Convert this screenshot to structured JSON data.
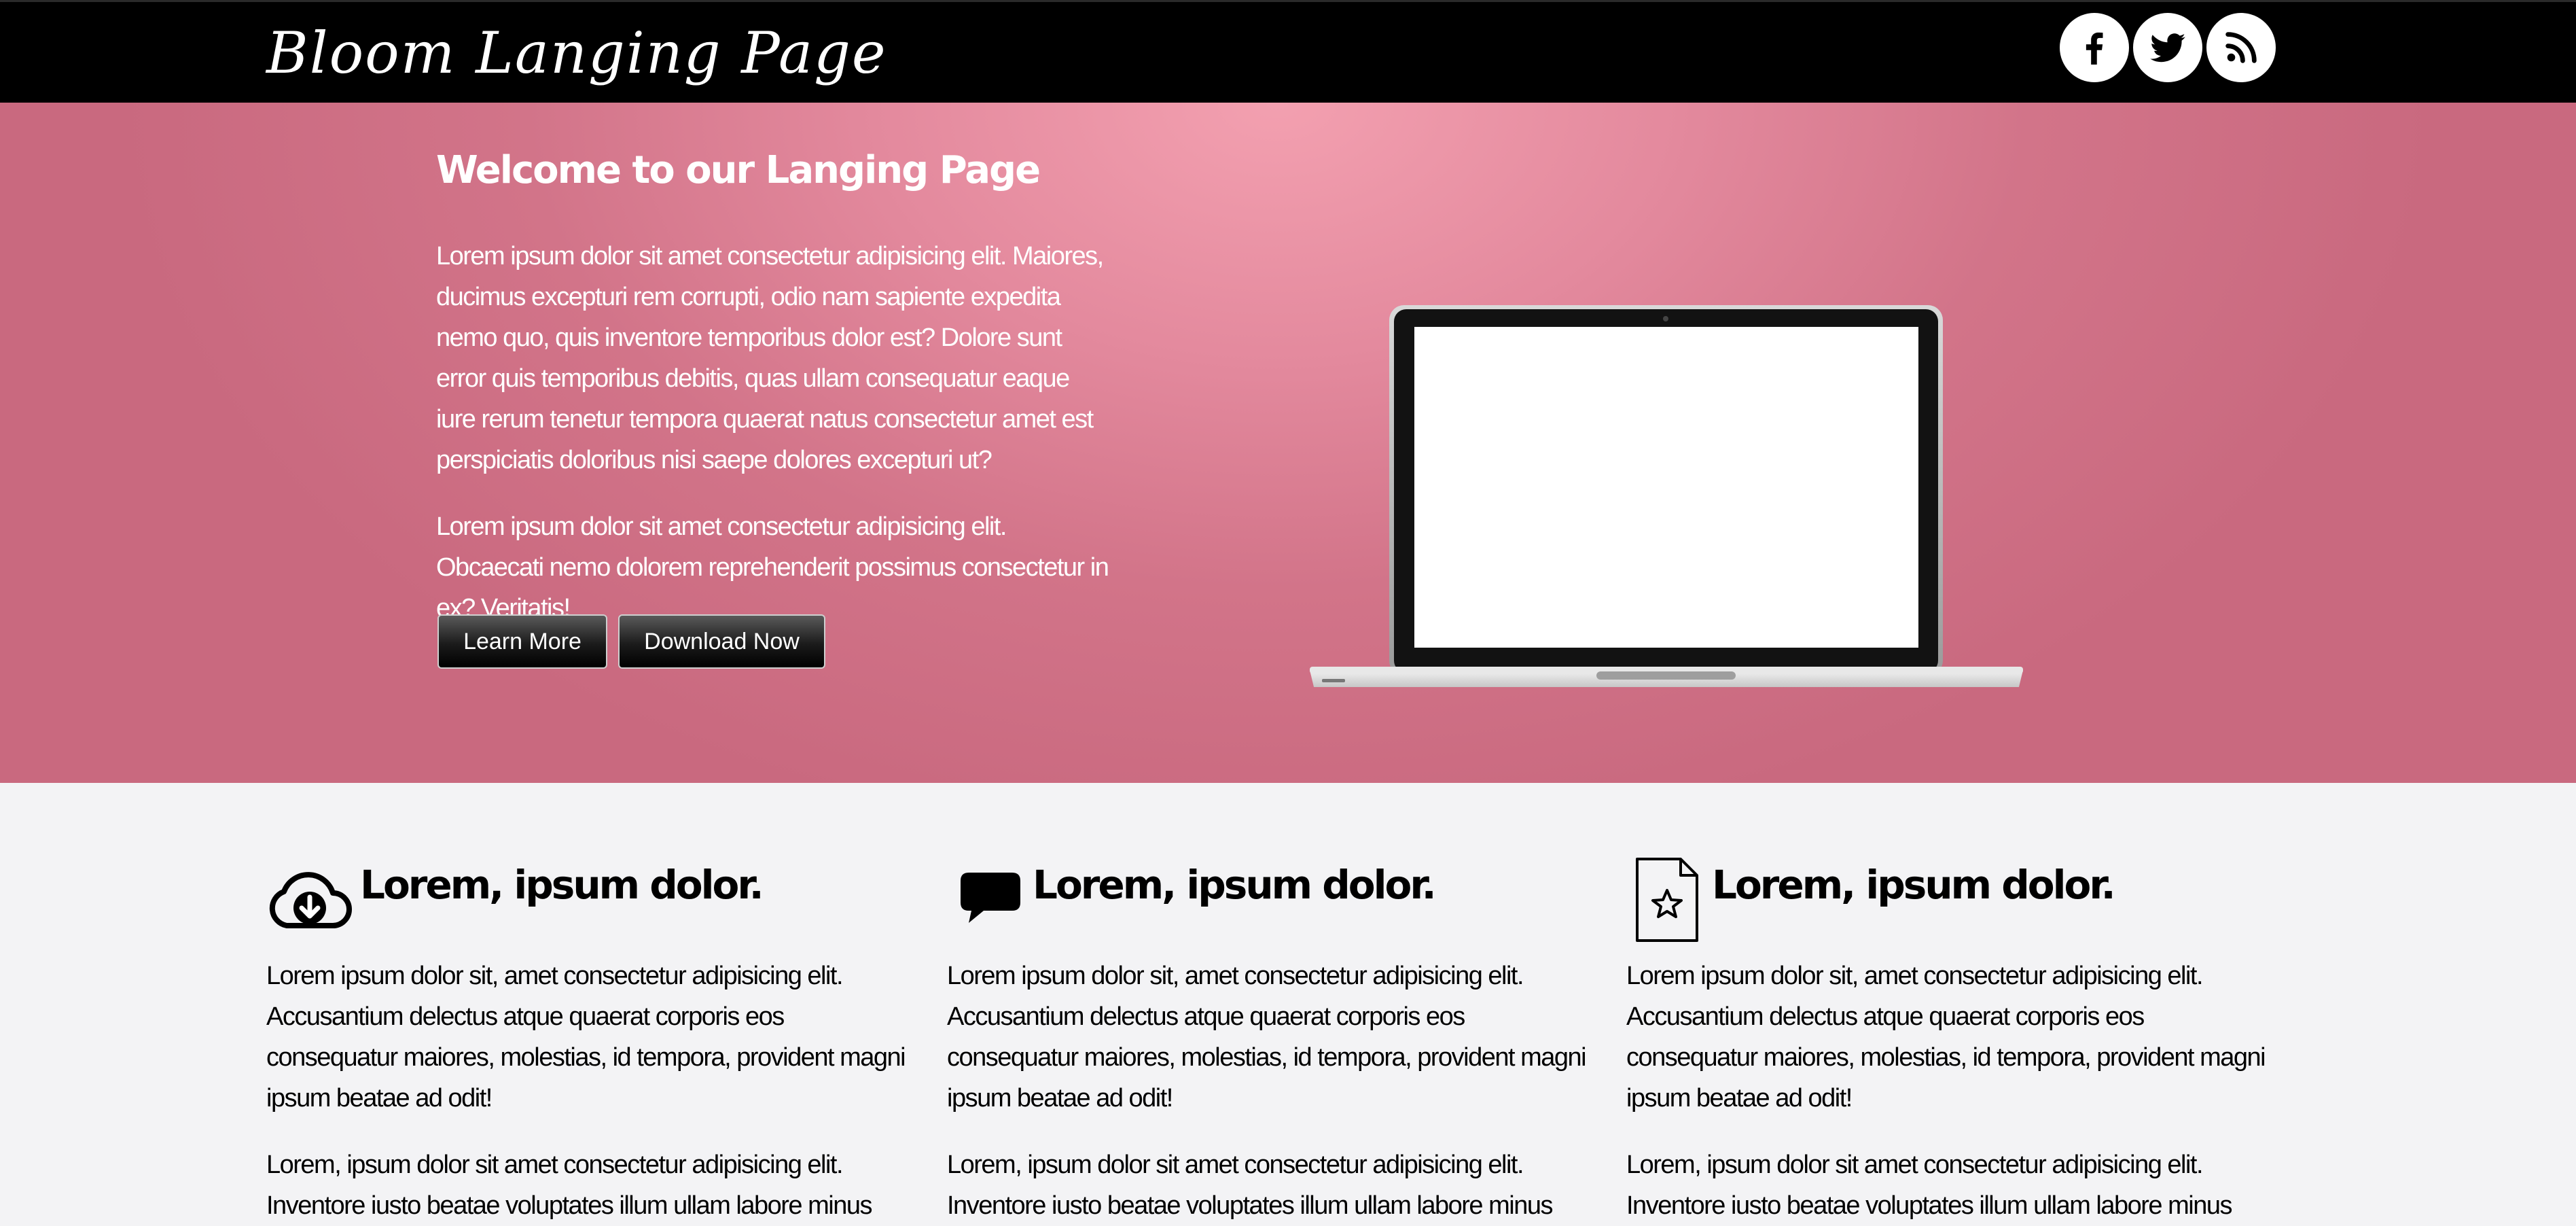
{
  "header": {
    "brand": "Bloom Langing Page",
    "social": [
      {
        "name": "facebook",
        "icon": "facebook-icon"
      },
      {
        "name": "twitter",
        "icon": "twitter-icon"
      },
      {
        "name": "rss",
        "icon": "rss-icon"
      }
    ]
  },
  "hero": {
    "title": "Welcome to our Langing Page",
    "paragraph1": "Lorem ipsum dolor sit amet consectetur adipisicing elit. Maiores, ducimus excepturi rem corrupti, odio nam sapiente expedita nemo quo, quis inventore temporibus dolor est? Dolore sunt error quis temporibus debitis, quas ullam consequatur eaque iure rerum tenetur tempora quaerat natus consectetur amet est perspiciatis doloribus nisi saepe dolores excepturi ut?",
    "paragraph2": "Lorem ipsum dolor sit amet consectetur adipisicing elit. Obcaecati nemo dolorem reprehenderit possimus consectetur in ex? Veritatis!",
    "learn_more": "Learn More",
    "download_now": "Download Now",
    "image": "laptop-image"
  },
  "features": [
    {
      "icon": "cloud-download-icon",
      "title": "Lorem, ipsum dolor.",
      "p1": "Lorem ipsum dolor sit, amet consectetur adipisicing elit. Accusantium delectus atque quaerat corporis eos consequatur maiores, molestias, id tempora, provident magni ipsum beatae ad odit!",
      "p2": "Lorem, ipsum dolor sit amet consectetur adipisicing elit. Inventore iusto beatae voluptates illum ullam labore minus"
    },
    {
      "icon": "chat-bubble-icon",
      "title": "Lorem, ipsum dolor.",
      "p1": "Lorem ipsum dolor sit, amet consectetur adipisicing elit. Accusantium delectus atque quaerat corporis eos consequatur maiores, molestias, id tempora, provident magni ipsum beatae ad odit!",
      "p2": "Lorem, ipsum dolor sit amet consectetur adipisicing elit. Inventore iusto beatae voluptates illum ullam labore minus"
    },
    {
      "icon": "document-star-icon",
      "title": "Lorem, ipsum dolor.",
      "p1": "Lorem ipsum dolor sit, amet consectetur adipisicing elit. Accusantium delectus atque quaerat corporis eos consequatur maiores, molestias, id tempora, provident magni ipsum beatae ad odit!",
      "p2": "Lorem, ipsum dolor sit amet consectetur adipisicing elit. Inventore iusto beatae voluptates illum ullam labore minus"
    }
  ],
  "colors": {
    "header_bg": "#000000",
    "hero_pink": "#e3899d",
    "page_bg": "#f3f3f5"
  }
}
